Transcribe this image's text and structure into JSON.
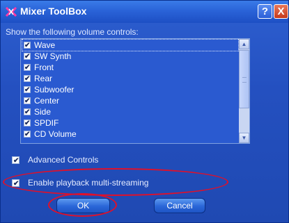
{
  "window": {
    "title": "Mixer ToolBox",
    "help_label": "?",
    "close_label": "X"
  },
  "prompt": "Show the following volume controls:",
  "list": {
    "items": [
      {
        "label": "Wave",
        "checked": true
      },
      {
        "label": "SW Synth",
        "checked": true
      },
      {
        "label": "Front",
        "checked": true
      },
      {
        "label": "Rear",
        "checked": true
      },
      {
        "label": "Subwoofer",
        "checked": true
      },
      {
        "label": "Center",
        "checked": true
      },
      {
        "label": "Side",
        "checked": true
      },
      {
        "label": "SPDIF",
        "checked": true
      },
      {
        "label": "CD Volume",
        "checked": true
      }
    ],
    "scroll_up_icon": "scroll-up-arrow",
    "scroll_down_icon": "scroll-down-arrow"
  },
  "options": {
    "advanced_controls": {
      "label": "Advanced Controls",
      "checked": true
    },
    "multi_streaming": {
      "label": "Enable playback multi-streaming",
      "checked": true
    }
  },
  "buttons": {
    "ok": "OK",
    "cancel": "Cancel"
  },
  "colors": {
    "annotation": "#e0102a"
  }
}
